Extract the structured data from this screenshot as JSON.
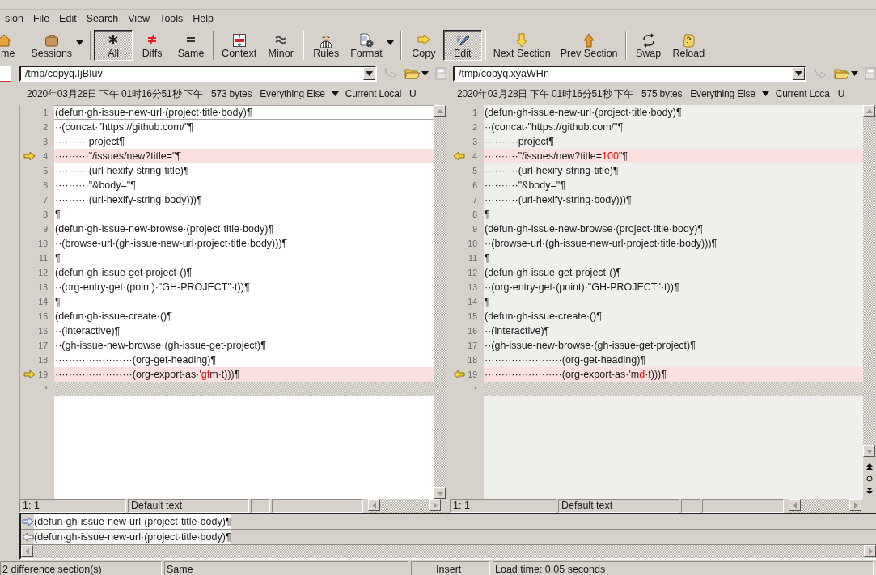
{
  "menu": [
    {
      "label": "sion"
    },
    {
      "label": "File"
    },
    {
      "label": "Edit"
    },
    {
      "label": "Search"
    },
    {
      "label": "View"
    },
    {
      "label": "Tools"
    },
    {
      "label": "Help"
    }
  ],
  "toolbar": [
    {
      "kind": "button",
      "label": "me",
      "selected": false,
      "dropdown": false
    },
    {
      "kind": "button",
      "label": "Sessions",
      "selected": false,
      "dropdown": true
    },
    {
      "kind": "separator"
    },
    {
      "kind": "button",
      "label": "All",
      "selected": true,
      "dropdown": false
    },
    {
      "kind": "button",
      "label": "Diffs",
      "selected": false,
      "dropdown": false
    },
    {
      "kind": "button",
      "label": "Same",
      "selected": false,
      "dropdown": false
    },
    {
      "kind": "separator"
    },
    {
      "kind": "button",
      "label": "Context",
      "selected": false,
      "dropdown": false
    },
    {
      "kind": "button",
      "label": "Minor",
      "selected": false,
      "dropdown": false
    },
    {
      "kind": "separator"
    },
    {
      "kind": "button",
      "label": "Rules",
      "selected": false,
      "dropdown": false
    },
    {
      "kind": "button",
      "label": "Format",
      "selected": false,
      "dropdown": true
    },
    {
      "kind": "separator"
    },
    {
      "kind": "button",
      "label": "Copy",
      "selected": false,
      "dropdown": false
    },
    {
      "kind": "button",
      "label": "Edit",
      "selected": true,
      "dropdown": false
    },
    {
      "kind": "separator"
    },
    {
      "kind": "button",
      "label": "Next Section",
      "selected": false,
      "dropdown": false
    },
    {
      "kind": "button",
      "label": "Prev Section",
      "selected": false,
      "dropdown": false
    },
    {
      "kind": "separator"
    },
    {
      "kind": "button",
      "label": "Swap",
      "selected": false,
      "dropdown": false
    },
    {
      "kind": "button",
      "label": "Reload",
      "selected": false,
      "dropdown": false
    }
  ],
  "sides": [
    {
      "active": true,
      "path": "/tmp/copyq.IjBIuv",
      "date": "2020年03月28日 下午 01时16分51秒 下午",
      "size": "573 bytes",
      "format": "Everything Else",
      "charset": "Current Local",
      "extra": "U",
      "end_mark": "*",
      "lines": [
        {
          "number": "1",
          "diff": false,
          "text": "(defun·gh-issue-new-url·(project·title·body)¶"
        },
        {
          "number": "2",
          "diff": false,
          "text": "··(concat·\"https://github.com/\"¶"
        },
        {
          "number": "3",
          "diff": false,
          "text": "··········project¶"
        },
        {
          "number": "4",
          "diff": true,
          "text": "··········\"/issues/new?title=\"¶"
        },
        {
          "number": "5",
          "diff": false,
          "text": "··········(url-hexify-string·title)¶"
        },
        {
          "number": "6",
          "diff": false,
          "text": "··········\"&body=\"¶"
        },
        {
          "number": "7",
          "diff": false,
          "text": "··········(url-hexify-string·body)))¶"
        },
        {
          "number": "8",
          "diff": false,
          "text": "¶"
        },
        {
          "number": "9",
          "diff": false,
          "text": "(defun·gh-issue-new-browse·(project·title·body)¶"
        },
        {
          "number": "10",
          "diff": false,
          "text": "··(browse-url·(gh-issue-new-url·project·title·body)))¶"
        },
        {
          "number": "11",
          "diff": false,
          "text": "¶"
        },
        {
          "number": "12",
          "diff": false,
          "text": "(defun·gh-issue-get-project·()¶"
        },
        {
          "number": "13",
          "diff": false,
          "text": "··(org-entry-get·(point)·\"GH-PROJECT\"·t))¶"
        },
        {
          "number": "14",
          "diff": false,
          "text": "¶"
        },
        {
          "number": "15",
          "diff": false,
          "text": "(defun·gh-issue-create·()¶"
        },
        {
          "number": "16",
          "diff": false,
          "text": "··(interactive)¶"
        },
        {
          "number": "17",
          "diff": false,
          "text": "··(gh-issue-new-browse·(gh-issue-get-project)¶"
        },
        {
          "number": "18",
          "diff": false,
          "text": "·······················(org-get-heading)¶"
        },
        {
          "number": "19",
          "diff": true,
          "parts": [
            {
              "text": "·······················(org-export-as·'",
              "changed": false
            },
            {
              "text": "gf",
              "changed": true
            },
            {
              "text": "m·t)))¶",
              "changed": false
            }
          ]
        }
      ],
      "status": {
        "position": "1: 1",
        "text_type": "Default text"
      }
    },
    {
      "active": false,
      "path": "/tmp/copyq.xyaWHn",
      "date": "2020年03月28日 下午 01时16分51秒 下午",
      "size": "575 bytes",
      "format": "Everything Else",
      "charset": "Current Loca",
      "extra": "U",
      "end_mark": "*",
      "lines": [
        {
          "number": "1",
          "diff": false,
          "text": "(defun·gh-issue-new-url·(project·title·body)¶"
        },
        {
          "number": "2",
          "diff": false,
          "text": "··(concat·\"https://github.com/\"¶"
        },
        {
          "number": "3",
          "diff": false,
          "text": "··········project¶"
        },
        {
          "number": "4",
          "diff": true,
          "parts": [
            {
              "text": "··········\"/issues/new?title=",
              "changed": false
            },
            {
              "text": "100",
              "changed": true
            },
            {
              "text": "\"¶",
              "changed": false
            }
          ]
        },
        {
          "number": "5",
          "diff": false,
          "text": "··········(url-hexify-string·title)¶"
        },
        {
          "number": "6",
          "diff": false,
          "text": "··········\"&body=\"¶"
        },
        {
          "number": "7",
          "diff": false,
          "text": "··········(url-hexify-string·body)))¶"
        },
        {
          "number": "8",
          "diff": false,
          "text": "¶"
        },
        {
          "number": "9",
          "diff": false,
          "text": "(defun·gh-issue-new-browse·(project·title·body)¶"
        },
        {
          "number": "10",
          "diff": false,
          "text": "··(browse-url·(gh-issue-new-url·project·title·body)))¶"
        },
        {
          "number": "11",
          "diff": false,
          "text": "¶"
        },
        {
          "number": "12",
          "diff": false,
          "text": "(defun·gh-issue-get-project·()¶"
        },
        {
          "number": "13",
          "diff": false,
          "text": "··(org-entry-get·(point)·\"GH-PROJECT\"·t))¶"
        },
        {
          "number": "14",
          "diff": false,
          "text": "¶"
        },
        {
          "number": "15",
          "diff": false,
          "text": "(defun·gh-issue-create·()¶"
        },
        {
          "number": "16",
          "diff": false,
          "text": "··(interactive)¶"
        },
        {
          "number": "17",
          "diff": false,
          "text": "··(gh-issue-new-browse·(gh-issue-get-project)¶"
        },
        {
          "number": "18",
          "diff": false,
          "text": "·······················(org-get-heading)¶"
        },
        {
          "number": "19",
          "diff": true,
          "parts": [
            {
              "text": "·······················(org-export-as·'m",
              "changed": false
            },
            {
              "text": "d",
              "changed": true
            },
            {
              "text": "·t)))¶",
              "changed": false
            }
          ]
        }
      ],
      "status": {
        "position": "1: 1",
        "text_type": "Default text"
      }
    }
  ],
  "line_compare": [
    {
      "text": "(defun·gh-issue-new-url·(project·title·body)¶"
    },
    {
      "text": "(defun·gh-issue-new-url·(project·title·body)¶"
    }
  ],
  "status_bar": [
    "2 difference section(s)",
    "Same",
    "Insert",
    "Load time: 0.05 seconds"
  ]
}
